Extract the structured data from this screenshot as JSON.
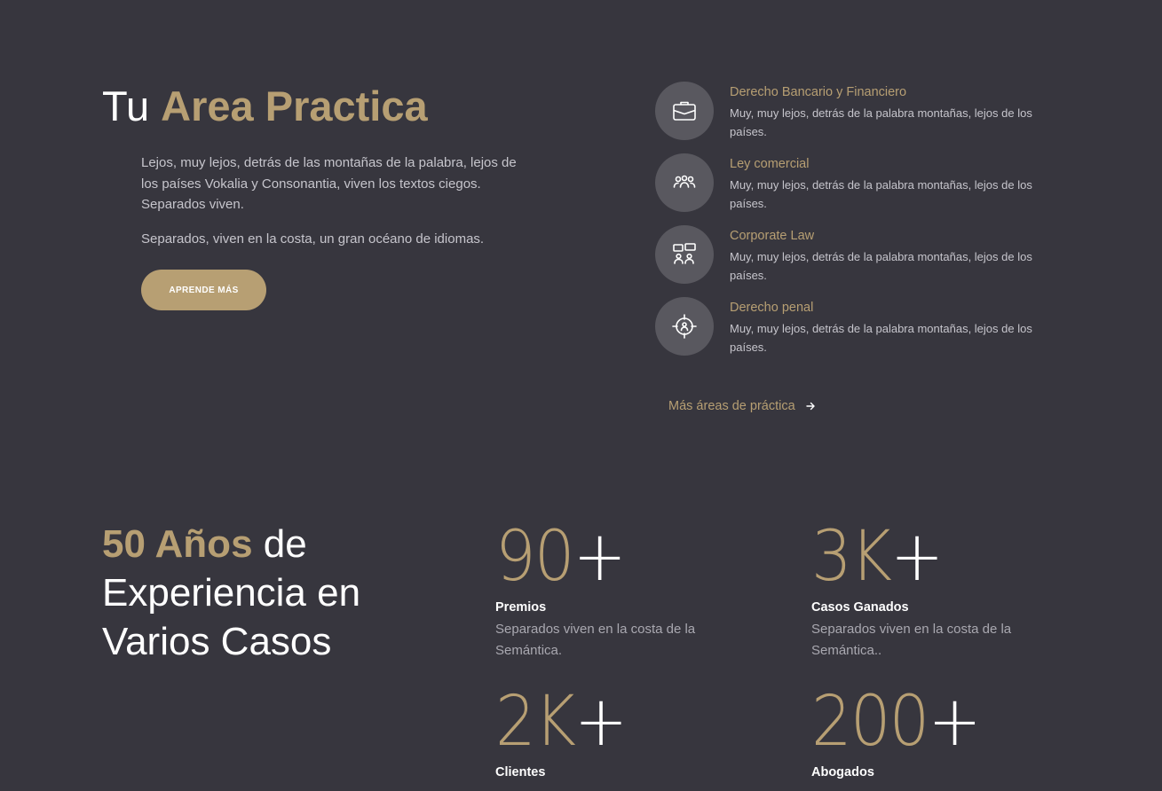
{
  "practice": {
    "title_prefix": "Tu",
    "title_accent": "Area Practica",
    "paragraph_1": "Lejos, muy lejos, detrás de las montañas de la palabra, lejos de los países Vokalia y Consonantia, viven los textos ciegos. Separados viven.",
    "paragraph_2": "Separados, viven en la costa, un gran océano de idiomas.",
    "button_label": "APRENDE MÁS",
    "services": [
      {
        "icon": "briefcase-icon",
        "title": "Derecho Bancario y Financiero",
        "desc": "Muy, muy lejos, detrás de la palabra montañas, lejos de los países."
      },
      {
        "icon": "group-icon",
        "title": "Ley comercial",
        "desc": "Muy, muy lejos, detrás de la palabra montañas, lejos de los países."
      },
      {
        "icon": "meeting-icon",
        "title": "Corporate Law",
        "desc": "Muy, muy lejos, detrás de la palabra montañas, lejos de los países."
      },
      {
        "icon": "target-person-icon",
        "title": "Derecho penal",
        "desc": "Muy, muy lejos, detrás de la palabra montañas, lejos de los países."
      }
    ],
    "more_link": "Más áreas de práctica"
  },
  "experience": {
    "title_accent": "50 Años",
    "title_rest": "de Experiencia en Varios Casos",
    "stats": [
      {
        "number": "90",
        "suffix": "+",
        "label": "Premios",
        "desc": "Separados viven en la costa de la Semántica."
      },
      {
        "number": "3K",
        "suffix": "+",
        "label": "Casos Ganados",
        "desc": "Separados viven en la costa de la Semántica.."
      },
      {
        "number": "2K",
        "suffix": "+",
        "label": "Clientes",
        "desc": ""
      },
      {
        "number": "200",
        "suffix": "+",
        "label": "Abogados",
        "desc": ""
      }
    ]
  },
  "colors": {
    "background": "#37363e",
    "accent": "#b79f73",
    "icon_circle": "#59585f",
    "text": "#c6c5cc"
  }
}
